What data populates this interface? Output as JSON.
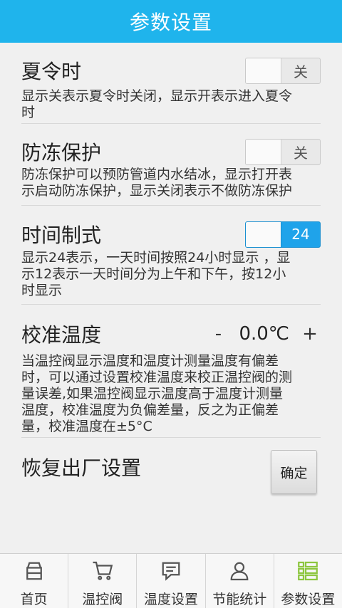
{
  "header": {
    "title": "参数设置"
  },
  "settings": {
    "dst": {
      "title": "夏令时",
      "toggle_text": "关",
      "desc_line1": "显示关表示夏令时关闭，显示开表示进入夏令",
      "desc_line2": "时"
    },
    "antifreeze": {
      "title": "防冻保护",
      "toggle_text": "关",
      "desc_line1": "防冻保护可以预防管道内水结冰，显示打开表",
      "desc_line2": "示启动防冻保护，显示关闭表示不做防冻保护"
    },
    "time_format": {
      "title": "时间制式",
      "toggle_text": "24",
      "desc_line1": "显示24表示，一天时间按照24小时显示 ，显",
      "desc_line2": "示12表示一天时间分为上午和下午，按12小",
      "desc_line3": "时显示"
    },
    "calibration": {
      "title": "校准温度",
      "minus": "-",
      "value": "0.0℃",
      "plus": "+",
      "desc_line1": "当温控阀显示温度和温度计测量温度有偏差",
      "desc_line2": "时，可以通过设置校准温度来校正温控阀的测",
      "desc_line3": "量误差,如果温控阀显示温度高于温度计测量",
      "desc_line4": "温度，校准温度为负偏差量，反之为正偏差",
      "desc_line5": "量，校准温度在±5°C"
    },
    "factory_reset": {
      "title": "恢复出厂设置",
      "button": "确定"
    }
  },
  "tabs": [
    {
      "label": "首页",
      "icon": "home-icon"
    },
    {
      "label": "温控阀",
      "icon": "cart-icon"
    },
    {
      "label": "温度设置",
      "icon": "message-icon"
    },
    {
      "label": "节能统计",
      "icon": "user-icon"
    },
    {
      "label": "参数设置",
      "icon": "grid-list-icon",
      "active": true
    }
  ],
  "colors": {
    "header": "#1fb4ec",
    "toggle_on": "#1fa3ea",
    "active_tab_icon": "#8dc63f"
  }
}
